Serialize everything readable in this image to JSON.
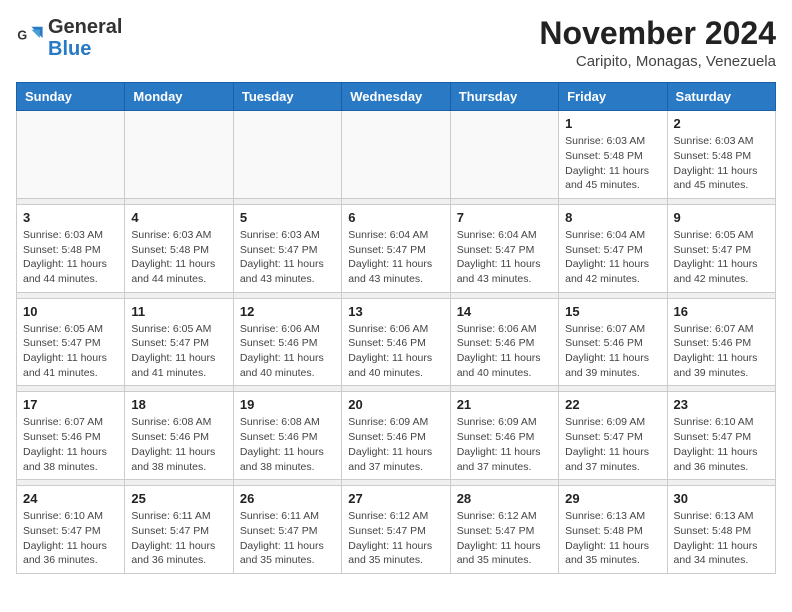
{
  "header": {
    "logo_general": "General",
    "logo_blue": "Blue",
    "month_year": "November 2024",
    "location": "Caripito, Monagas, Venezuela"
  },
  "days_of_week": [
    "Sunday",
    "Monday",
    "Tuesday",
    "Wednesday",
    "Thursday",
    "Friday",
    "Saturday"
  ],
  "weeks": [
    {
      "days": [
        {
          "number": "",
          "info": ""
        },
        {
          "number": "",
          "info": ""
        },
        {
          "number": "",
          "info": ""
        },
        {
          "number": "",
          "info": ""
        },
        {
          "number": "",
          "info": ""
        },
        {
          "number": "1",
          "info": "Sunrise: 6:03 AM\nSunset: 5:48 PM\nDaylight: 11 hours\nand 45 minutes."
        },
        {
          "number": "2",
          "info": "Sunrise: 6:03 AM\nSunset: 5:48 PM\nDaylight: 11 hours\nand 45 minutes."
        }
      ]
    },
    {
      "days": [
        {
          "number": "3",
          "info": "Sunrise: 6:03 AM\nSunset: 5:48 PM\nDaylight: 11 hours\nand 44 minutes."
        },
        {
          "number": "4",
          "info": "Sunrise: 6:03 AM\nSunset: 5:48 PM\nDaylight: 11 hours\nand 44 minutes."
        },
        {
          "number": "5",
          "info": "Sunrise: 6:03 AM\nSunset: 5:47 PM\nDaylight: 11 hours\nand 43 minutes."
        },
        {
          "number": "6",
          "info": "Sunrise: 6:04 AM\nSunset: 5:47 PM\nDaylight: 11 hours\nand 43 minutes."
        },
        {
          "number": "7",
          "info": "Sunrise: 6:04 AM\nSunset: 5:47 PM\nDaylight: 11 hours\nand 43 minutes."
        },
        {
          "number": "8",
          "info": "Sunrise: 6:04 AM\nSunset: 5:47 PM\nDaylight: 11 hours\nand 42 minutes."
        },
        {
          "number": "9",
          "info": "Sunrise: 6:05 AM\nSunset: 5:47 PM\nDaylight: 11 hours\nand 42 minutes."
        }
      ]
    },
    {
      "days": [
        {
          "number": "10",
          "info": "Sunrise: 6:05 AM\nSunset: 5:47 PM\nDaylight: 11 hours\nand 41 minutes."
        },
        {
          "number": "11",
          "info": "Sunrise: 6:05 AM\nSunset: 5:47 PM\nDaylight: 11 hours\nand 41 minutes."
        },
        {
          "number": "12",
          "info": "Sunrise: 6:06 AM\nSunset: 5:46 PM\nDaylight: 11 hours\nand 40 minutes."
        },
        {
          "number": "13",
          "info": "Sunrise: 6:06 AM\nSunset: 5:46 PM\nDaylight: 11 hours\nand 40 minutes."
        },
        {
          "number": "14",
          "info": "Sunrise: 6:06 AM\nSunset: 5:46 PM\nDaylight: 11 hours\nand 40 minutes."
        },
        {
          "number": "15",
          "info": "Sunrise: 6:07 AM\nSunset: 5:46 PM\nDaylight: 11 hours\nand 39 minutes."
        },
        {
          "number": "16",
          "info": "Sunrise: 6:07 AM\nSunset: 5:46 PM\nDaylight: 11 hours\nand 39 minutes."
        }
      ]
    },
    {
      "days": [
        {
          "number": "17",
          "info": "Sunrise: 6:07 AM\nSunset: 5:46 PM\nDaylight: 11 hours\nand 38 minutes."
        },
        {
          "number": "18",
          "info": "Sunrise: 6:08 AM\nSunset: 5:46 PM\nDaylight: 11 hours\nand 38 minutes."
        },
        {
          "number": "19",
          "info": "Sunrise: 6:08 AM\nSunset: 5:46 PM\nDaylight: 11 hours\nand 38 minutes."
        },
        {
          "number": "20",
          "info": "Sunrise: 6:09 AM\nSunset: 5:46 PM\nDaylight: 11 hours\nand 37 minutes."
        },
        {
          "number": "21",
          "info": "Sunrise: 6:09 AM\nSunset: 5:46 PM\nDaylight: 11 hours\nand 37 minutes."
        },
        {
          "number": "22",
          "info": "Sunrise: 6:09 AM\nSunset: 5:47 PM\nDaylight: 11 hours\nand 37 minutes."
        },
        {
          "number": "23",
          "info": "Sunrise: 6:10 AM\nSunset: 5:47 PM\nDaylight: 11 hours\nand 36 minutes."
        }
      ]
    },
    {
      "days": [
        {
          "number": "24",
          "info": "Sunrise: 6:10 AM\nSunset: 5:47 PM\nDaylight: 11 hours\nand 36 minutes."
        },
        {
          "number": "25",
          "info": "Sunrise: 6:11 AM\nSunset: 5:47 PM\nDaylight: 11 hours\nand 36 minutes."
        },
        {
          "number": "26",
          "info": "Sunrise: 6:11 AM\nSunset: 5:47 PM\nDaylight: 11 hours\nand 35 minutes."
        },
        {
          "number": "27",
          "info": "Sunrise: 6:12 AM\nSunset: 5:47 PM\nDaylight: 11 hours\nand 35 minutes."
        },
        {
          "number": "28",
          "info": "Sunrise: 6:12 AM\nSunset: 5:47 PM\nDaylight: 11 hours\nand 35 minutes."
        },
        {
          "number": "29",
          "info": "Sunrise: 6:13 AM\nSunset: 5:48 PM\nDaylight: 11 hours\nand 35 minutes."
        },
        {
          "number": "30",
          "info": "Sunrise: 6:13 AM\nSunset: 5:48 PM\nDaylight: 11 hours\nand 34 minutes."
        }
      ]
    }
  ]
}
